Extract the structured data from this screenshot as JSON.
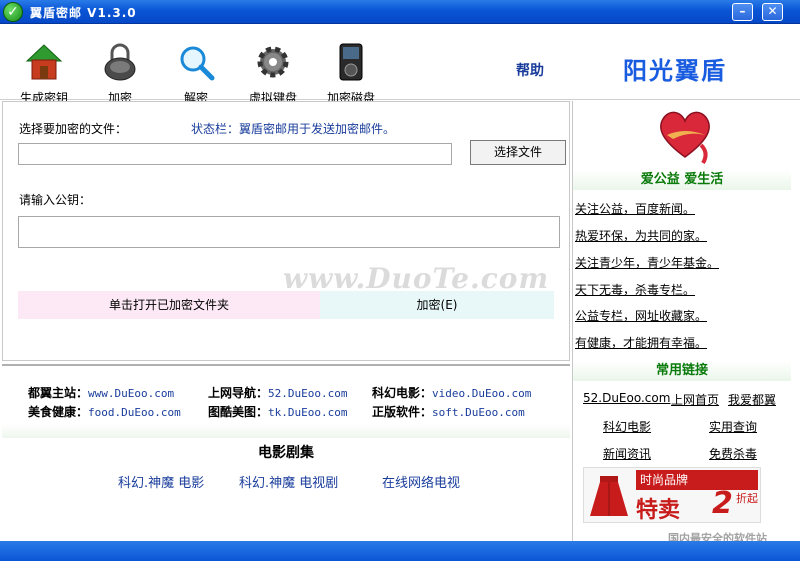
{
  "window": {
    "title": "翼盾密邮 V1.3.0",
    "minimize": "–",
    "close": "✕"
  },
  "toolbar": {
    "items": [
      {
        "label": "生成密钥",
        "icon": "house-icon"
      },
      {
        "label": "加密",
        "icon": "lock-icon"
      },
      {
        "label": "解密",
        "icon": "magnifier-icon"
      },
      {
        "label": "虚拟键盘",
        "icon": "gear-icon"
      },
      {
        "label": "加密磁盘",
        "icon": "disk-icon"
      }
    ],
    "help": "帮助",
    "brand": "阳光翼盾"
  },
  "main": {
    "file_label": "选择要加密的文件：",
    "status": "状态栏：翼盾密邮用于发送加密邮件。",
    "file_value": "",
    "select_button": "选择文件",
    "key_label": "请输入公钥：",
    "key_value": "",
    "open_folder_button": "单击打开已加密文件夹",
    "encrypt_button": "加密(E)"
  },
  "links": {
    "rows": [
      [
        {
          "label": "都翼主站：",
          "url": "www.DuEoo.com"
        },
        {
          "label": "上网导航：",
          "url": "52.DuEoo.com"
        },
        {
          "label": "科幻电影：",
          "url": "video.DuEoo.com"
        }
      ],
      [
        {
          "label": "美食健康：",
          "url": "food.DuEoo.com"
        },
        {
          "label": "图酷美图：",
          "url": "tk.DuEoo.com"
        },
        {
          "label": "正版软件：",
          "url": "soft.DuEoo.com"
        }
      ]
    ],
    "movie_title": "电影剧集",
    "movie_links": [
      "科幻.神魔 电影",
      "科幻.神魔 电视剧",
      "在线网络电视"
    ]
  },
  "right": {
    "love_title": "爱公益 爱生活",
    "items": [
      "关注公益，百度新闻。",
      "热爱环保，为共同的家。",
      "关注青少年，青少年基金。",
      "天下无毒，杀毒专栏。",
      "公益专栏，网址收藏家。",
      "有健康，才能拥有幸福。"
    ],
    "common_title": "常用链接",
    "common_row1": [
      "52.DuEoo.com",
      "上网首页",
      "我爱都翼"
    ],
    "common_row2": [
      "科幻电影",
      "实用查询"
    ],
    "common_row3": [
      "新闻资讯",
      "免费杀毒"
    ],
    "ad": {
      "top": "时尚品牌",
      "sale": "特卖",
      "num": "2",
      "off": "折起"
    }
  },
  "watermark": {
    "main": "www.DuoTe.com",
    "sub": "国内最安全的软件站"
  },
  "colors": {
    "titlebar": "#0a55d6",
    "link": "#1a3d9c",
    "green": "#0a7a0a",
    "ad": "#c81b1b"
  }
}
